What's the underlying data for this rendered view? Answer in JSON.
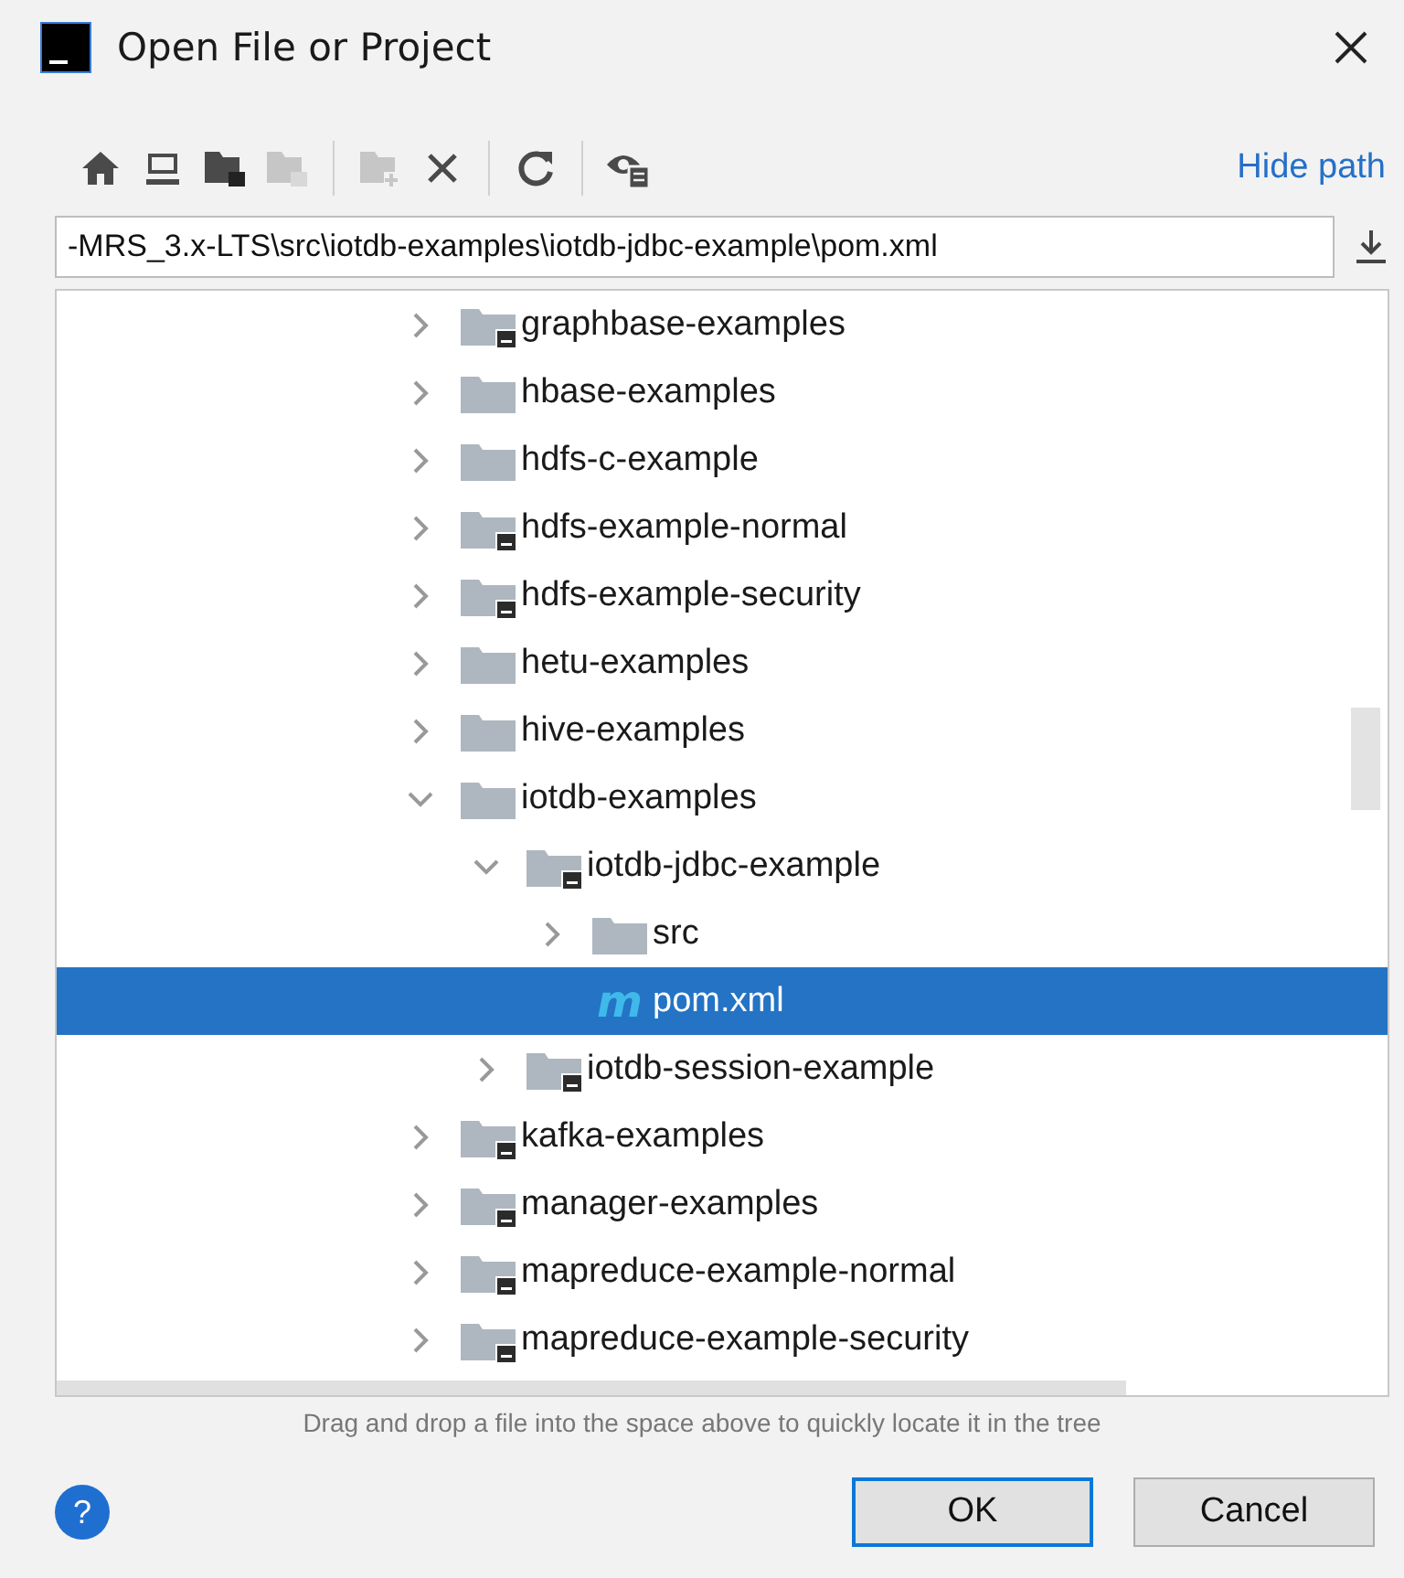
{
  "window": {
    "title": "Open File or Project"
  },
  "toolbar": {
    "buttons": [
      {
        "kind": "home",
        "disabled": false
      },
      {
        "kind": "desktop",
        "disabled": false
      },
      {
        "kind": "module-folder",
        "disabled": false
      },
      {
        "kind": "module-folder",
        "disabled": true
      },
      {
        "kind": "sep"
      },
      {
        "kind": "new-folder",
        "disabled": true
      },
      {
        "kind": "delete",
        "disabled": false
      },
      {
        "kind": "sep"
      },
      {
        "kind": "refresh",
        "disabled": false
      },
      {
        "kind": "sep"
      },
      {
        "kind": "show-hidden",
        "disabled": false
      }
    ],
    "link": "Hide path"
  },
  "path_field": {
    "value": "-MRS_3.x-LTS\\src\\iotdb-examples\\iotdb-jdbc-example\\pom.xml"
  },
  "tree": {
    "items": [
      {
        "label": "graphbase-examples",
        "kind": "module",
        "expanded": false,
        "selected": false
      },
      {
        "label": "hbase-examples",
        "kind": "folder",
        "expanded": false,
        "selected": false
      },
      {
        "label": "hdfs-c-example",
        "kind": "folder",
        "expanded": false,
        "selected": false
      },
      {
        "label": "hdfs-example-normal",
        "kind": "module",
        "expanded": false,
        "selected": false
      },
      {
        "label": "hdfs-example-security",
        "kind": "module",
        "expanded": false,
        "selected": false
      },
      {
        "label": "hetu-examples",
        "kind": "folder",
        "expanded": false,
        "selected": false
      },
      {
        "label": "hive-examples",
        "kind": "folder",
        "expanded": false,
        "selected": false
      },
      {
        "label": "iotdb-examples",
        "kind": "folder",
        "expanded": true,
        "selected": false,
        "children": [
          {
            "label": "iotdb-jdbc-example",
            "kind": "module",
            "expanded": true,
            "selected": false,
            "children": [
              {
                "label": "src",
                "kind": "folder",
                "expanded": false,
                "selected": false
              },
              {
                "label": "pom.xml",
                "kind": "maven",
                "icon_text": "m",
                "selected": true
              }
            ]
          },
          {
            "label": "iotdb-session-example",
            "kind": "module",
            "expanded": false,
            "selected": false
          }
        ]
      },
      {
        "label": "kafka-examples",
        "kind": "module",
        "expanded": false,
        "selected": false
      },
      {
        "label": "manager-examples",
        "kind": "module",
        "expanded": false,
        "selected": false
      },
      {
        "label": "mapreduce-example-normal",
        "kind": "module",
        "expanded": false,
        "selected": false
      },
      {
        "label": "mapreduce-example-security",
        "kind": "module",
        "expanded": false,
        "selected": false
      }
    ]
  },
  "hint": "Drag and drop a file into the space above to quickly locate it in the tree",
  "help_button": "?",
  "buttons": [
    {
      "label": "OK",
      "default": true
    },
    {
      "label": "Cancel",
      "default": false
    }
  ]
}
